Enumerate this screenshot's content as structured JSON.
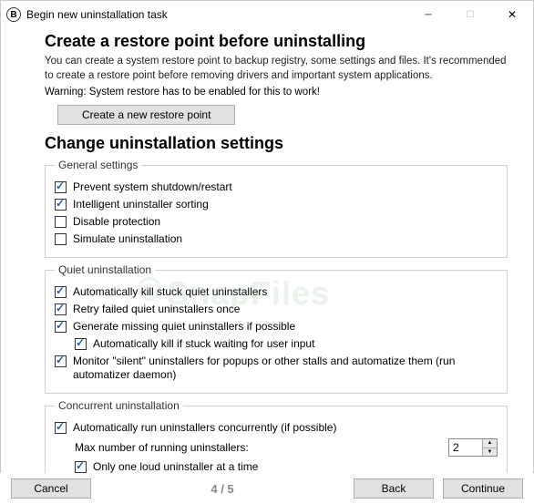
{
  "window": {
    "title": "Begin new uninstallation task"
  },
  "section1": {
    "heading": "Create a restore point before uninstalling",
    "desc": "You can create a system restore point to backup registry, some settings and files. It's recommended to create a restore point before removing drivers and important system applications.",
    "warning": "Warning: System restore has to be enabled for this to work!",
    "button": "Create a new restore point"
  },
  "section2": {
    "heading": "Change uninstallation settings",
    "group_general": {
      "legend": "General settings",
      "opt1": {
        "label": "Prevent system shutdown/restart",
        "checked": true
      },
      "opt2": {
        "label": "Intelligent uninstaller sorting",
        "checked": true
      },
      "opt3": {
        "label": "Disable protection",
        "checked": false
      },
      "opt4": {
        "label": "Simulate uninstallation",
        "checked": false
      }
    },
    "group_quiet": {
      "legend": "Quiet uninstallation",
      "opt1": {
        "label": "Automatically kill stuck quiet uninstallers",
        "checked": true
      },
      "opt2": {
        "label": "Retry failed quiet uninstallers once",
        "checked": true
      },
      "opt3": {
        "label": "Generate missing quiet uninstallers if possible",
        "checked": true
      },
      "opt3a": {
        "label": "Automatically kill if stuck waiting for user input",
        "checked": true
      },
      "opt4": {
        "label": "Monitor \"silent\" uninstallers for popups or other stalls and automatize them (run automatizer daemon)",
        "checked": true
      }
    },
    "group_concurrent": {
      "legend": "Concurrent uninstallation",
      "opt1": {
        "label": "Automatically run uninstallers concurrently (if possible)",
        "checked": true
      },
      "max_label": "Max number of running uninstallers:",
      "max_value": "2",
      "opt2": {
        "label": "Only one loud uninstaller at a time",
        "checked": true
      }
    }
  },
  "footer": {
    "cancel": "Cancel",
    "page": "4 / 5",
    "back": "Back",
    "continue": "Continue"
  },
  "watermark": "SnapFiles"
}
